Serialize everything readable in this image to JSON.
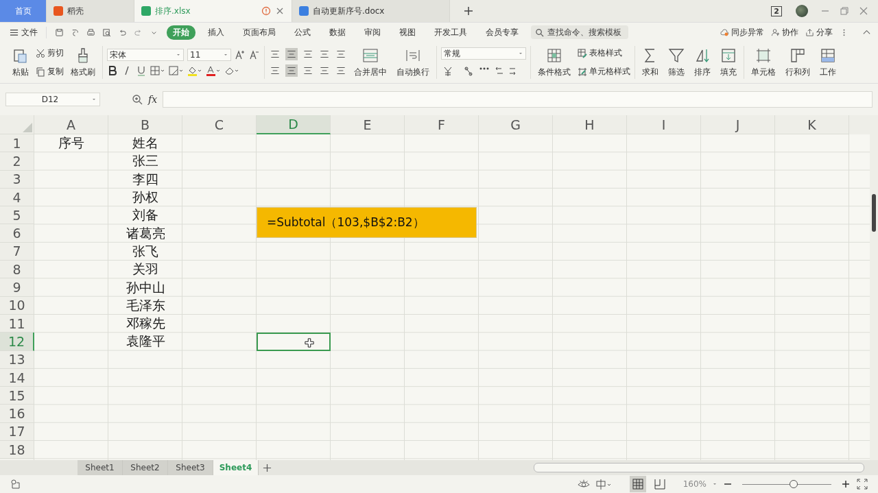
{
  "tabs": [
    {
      "label": "首页",
      "kind": "home",
      "selected": false
    },
    {
      "label": "稻壳",
      "kind": "docer",
      "selected": false
    },
    {
      "label": "排序.xlsx",
      "kind": "sheet",
      "selected": true
    },
    {
      "label": "自动更新序号.docx",
      "kind": "doc",
      "selected": false
    }
  ],
  "window_badge": "2",
  "menu": {
    "file": "文件",
    "items": [
      {
        "label": "开始",
        "selected": true
      },
      {
        "label": "插入",
        "selected": false
      },
      {
        "label": "页面布局",
        "selected": false
      },
      {
        "label": "公式",
        "selected": false
      },
      {
        "label": "数据",
        "selected": false
      },
      {
        "label": "审阅",
        "selected": false
      },
      {
        "label": "视图",
        "selected": false
      },
      {
        "label": "开发工具",
        "selected": false
      },
      {
        "label": "会员专享",
        "selected": false
      }
    ],
    "search": {
      "placeholder": "查找命令、搜索模板"
    },
    "sync": "同步异常",
    "collab": "协作",
    "share": "分享"
  },
  "ribbon": {
    "paste": "粘贴",
    "cut": "剪切",
    "copy": "复制",
    "format_painter": "格式刷",
    "font": "宋体",
    "size": "11",
    "merge": "合并居中",
    "wrap": "自动换行",
    "number_format": "常规",
    "table_style": "表格样式",
    "conditional": "条件格式",
    "cell_style": "单元格样式",
    "sum": "求和",
    "filter": "筛选",
    "sort": "排序",
    "fill": "填充",
    "cell": "单元格",
    "rows_cols": "行和列",
    "sheet": "工作"
  },
  "formula_bar": {
    "name_box": "D12",
    "fx": "fx"
  },
  "columns": [
    {
      "label": "A",
      "selected": false
    },
    {
      "label": "B",
      "selected": false
    },
    {
      "label": "C",
      "selected": false
    },
    {
      "label": "D",
      "selected": true
    },
    {
      "label": "E",
      "selected": false
    },
    {
      "label": "F",
      "selected": false
    },
    {
      "label": "G",
      "selected": false
    },
    {
      "label": "H",
      "selected": false
    },
    {
      "label": "I",
      "selected": false
    },
    {
      "label": "J",
      "selected": false
    },
    {
      "label": "K",
      "selected": false
    }
  ],
  "rows": [
    {
      "number": "1",
      "selected": false,
      "cells": [
        "序号",
        "姓名"
      ]
    },
    {
      "number": "2",
      "selected": false,
      "cells": [
        "",
        "张三"
      ]
    },
    {
      "number": "3",
      "selected": false,
      "cells": [
        "",
        "李四"
      ]
    },
    {
      "number": "4",
      "selected": false,
      "cells": [
        "",
        "孙权"
      ]
    },
    {
      "number": "5",
      "selected": false,
      "cells": [
        "",
        "刘备"
      ]
    },
    {
      "number": "6",
      "selected": false,
      "cells": [
        "",
        "诸葛亮"
      ]
    },
    {
      "number": "7",
      "selected": false,
      "cells": [
        "",
        "张飞"
      ]
    },
    {
      "number": "8",
      "selected": false,
      "cells": [
        "",
        "关羽"
      ]
    },
    {
      "number": "9",
      "selected": false,
      "cells": [
        "",
        "孙中山"
      ]
    },
    {
      "number": "10",
      "selected": false,
      "cells": [
        "",
        "毛泽东"
      ]
    },
    {
      "number": "11",
      "selected": false,
      "cells": [
        "",
        "邓稼先"
      ]
    },
    {
      "number": "12",
      "selected": true,
      "cells": [
        "",
        "袁隆平"
      ]
    },
    {
      "number": "13",
      "selected": false,
      "cells": []
    },
    {
      "number": "14",
      "selected": false,
      "cells": []
    },
    {
      "number": "15",
      "selected": false,
      "cells": []
    },
    {
      "number": "16",
      "selected": false,
      "cells": []
    },
    {
      "number": "17",
      "selected": false,
      "cells": []
    },
    {
      "number": "18",
      "selected": false,
      "cells": []
    }
  ],
  "callout": "=Subtotal（103,$B$2:B2）",
  "sheets": [
    {
      "label": "Sheet1",
      "selected": false
    },
    {
      "label": "Sheet2",
      "selected": false
    },
    {
      "label": "Sheet3",
      "selected": false
    },
    {
      "label": "Sheet4",
      "selected": true
    }
  ],
  "status": {
    "zoom": "160%",
    "zoom_slider": {
      "level": 0.58
    }
  }
}
